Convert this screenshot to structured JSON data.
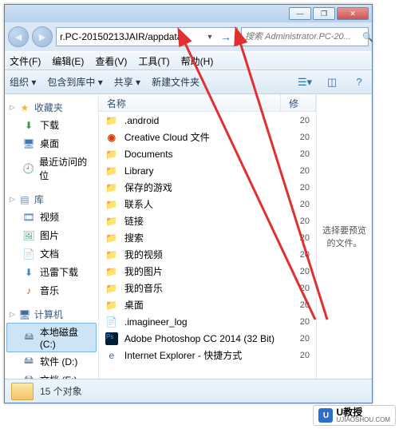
{
  "titlebar": {
    "min": "―",
    "max": "❐",
    "close": "✕"
  },
  "nav": {
    "back": "◄",
    "fwd": "►",
    "address": "r.PC-20150213JAIR/appdata",
    "dropdown": "▼",
    "go": "→",
    "search_placeholder": "搜索 Administrator.PC-20...",
    "mag": "🔍"
  },
  "menu": {
    "file": "文件(F)",
    "edit": "编辑(E)",
    "view": "查看(V)",
    "tools": "工具(T)",
    "help": "帮助(H)"
  },
  "toolbar": {
    "organize": "组织 ▾",
    "library": "包含到库中 ▾",
    "share": "共享 ▾",
    "newfolder": "新建文件夹"
  },
  "sidebar": {
    "fav": {
      "hdr": "收藏夹",
      "items": [
        {
          "icon": "dl",
          "label": "下载"
        },
        {
          "icon": "desk",
          "label": "桌面"
        },
        {
          "icon": "recent",
          "label": "最近访问的位"
        }
      ]
    },
    "lib": {
      "hdr": "库",
      "items": [
        {
          "icon": "vid",
          "label": "视频"
        },
        {
          "icon": "pic",
          "label": "图片"
        },
        {
          "icon": "doc",
          "label": "文档"
        },
        {
          "icon": "xun",
          "label": "迅雷下载"
        },
        {
          "icon": "mus",
          "label": "音乐"
        }
      ]
    },
    "comp": {
      "hdr": "计算机",
      "items": [
        {
          "icon": "disk",
          "label": "本地磁盘 (C:)",
          "sel": true
        },
        {
          "icon": "disk",
          "label": "软件 (D:)"
        },
        {
          "icon": "disk",
          "label": "文档 (E:)"
        }
      ]
    }
  },
  "list": {
    "hdr_name": "名称",
    "hdr_mod": "修",
    "rows": [
      {
        "icon": "fold",
        "glyph": "📁",
        "name": ".android",
        "mod": "20"
      },
      {
        "icon": "cc",
        "glyph": "◉",
        "name": "Creative Cloud 文件",
        "mod": "20"
      },
      {
        "icon": "fold",
        "glyph": "📁",
        "name": "Documents",
        "mod": "20"
      },
      {
        "icon": "fold",
        "glyph": "📁",
        "name": "Library",
        "mod": "20"
      },
      {
        "icon": "fold",
        "glyph": "📁",
        "name": "保存的游戏",
        "mod": "20"
      },
      {
        "icon": "fold",
        "glyph": "📁",
        "name": "联系人",
        "mod": "20"
      },
      {
        "icon": "fold",
        "glyph": "📁",
        "name": "链接",
        "mod": "20"
      },
      {
        "icon": "fold",
        "glyph": "📁",
        "name": "搜索",
        "mod": "20"
      },
      {
        "icon": "fold",
        "glyph": "📁",
        "name": "我的视频",
        "mod": "20"
      },
      {
        "icon": "fold",
        "glyph": "📁",
        "name": "我的图片",
        "mod": "20"
      },
      {
        "icon": "fold",
        "glyph": "📁",
        "name": "我的音乐",
        "mod": "20"
      },
      {
        "icon": "fold",
        "glyph": "📁",
        "name": "桌面",
        "mod": "20"
      },
      {
        "icon": "file",
        "glyph": "📄",
        "name": ".imagineer_log",
        "mod": "20"
      },
      {
        "icon": "ps",
        "glyph": "",
        "name": "Adobe Photoshop CC 2014 (32 Bit)",
        "mod": "20"
      },
      {
        "icon": "ie",
        "glyph": "e",
        "name": "Internet Explorer - 快捷方式",
        "mod": "20"
      }
    ]
  },
  "preview": "选择要预览的文件。",
  "status": {
    "count": "15 个对象"
  },
  "watermark": {
    "brand": "U教授",
    "url": "UJIAOSHOU.COM",
    "logo": "U"
  }
}
